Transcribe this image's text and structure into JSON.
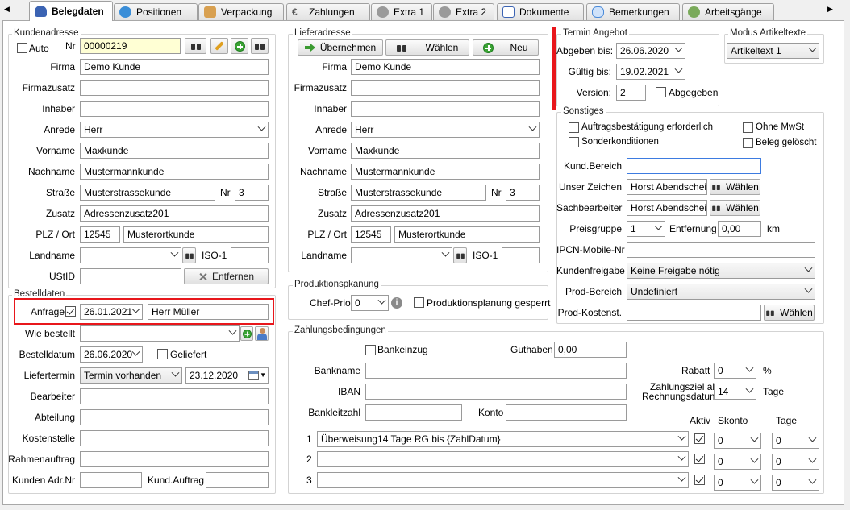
{
  "tabs": [
    {
      "label": "Belegdaten",
      "icon": "user-icon",
      "color": "#3b63b3"
    },
    {
      "label": "Positionen",
      "icon": "gears-icon",
      "color": "#3a8ed8"
    },
    {
      "label": "Verpackung",
      "icon": "box-icon",
      "color": "#d8a050"
    },
    {
      "label": "Zahlungen",
      "icon": "euro-icon",
      "color": "#555555"
    },
    {
      "label": "Extra 1",
      "icon": "gear-icon",
      "color": "#888888"
    },
    {
      "label": "Extra 2",
      "icon": "gear-icon",
      "color": "#888888"
    },
    {
      "label": "Dokumente",
      "icon": "document-icon",
      "color": "#3b63b3"
    },
    {
      "label": "Bemerkungen",
      "icon": "speech-bubble-icon",
      "color": "#4a8ad8"
    },
    {
      "label": "Arbeitsgänge",
      "icon": "cog-icon",
      "color": "#6a9a4a"
    }
  ],
  "kunde": {
    "title": "Kundenadresse",
    "auto_label": "Auto",
    "nr_label": "Nr",
    "nr_value": "00000219",
    "fields": [
      {
        "label": "Firma",
        "value": "Demo Kunde"
      },
      {
        "label": "Firmazusatz",
        "value": ""
      },
      {
        "label": "Inhaber",
        "value": ""
      },
      {
        "label": "Anrede",
        "value": "Herr"
      },
      {
        "label": "Vorname",
        "value": "Maxkunde"
      },
      {
        "label": "Nachname",
        "value": "Mustermannkunde"
      },
      {
        "label": "Straße",
        "value": "Musterstrassekunde",
        "nr_label": "Nr",
        "nr": "3"
      },
      {
        "label": "Zusatz",
        "value": "Adressenzusatz201"
      },
      {
        "label": "PLZ / Ort",
        "plz": "12545",
        "ort": "Musterortkunde"
      },
      {
        "label": "Landname",
        "value": "",
        "iso_label": "ISO-1",
        "iso": ""
      },
      {
        "label": "UStID",
        "value": "",
        "button": "Entfernen"
      }
    ]
  },
  "liefer": {
    "title": "Lieferadresse",
    "btn_uebernehmen": "Übernehmen",
    "btn_waehlen": "Wählen",
    "btn_neu": "Neu",
    "fields": [
      {
        "label": "Firma",
        "value": "Demo Kunde"
      },
      {
        "label": "Firmazusatz",
        "value": ""
      },
      {
        "label": "Inhaber",
        "value": ""
      },
      {
        "label": "Anrede",
        "value": "Herr"
      },
      {
        "label": "Vorname",
        "value": "Maxkunde"
      },
      {
        "label": "Nachname",
        "value": "Mustermannkunde"
      },
      {
        "label": "Straße",
        "value": "Musterstrassekunde",
        "nr_label": "Nr",
        "nr": "3"
      },
      {
        "label": "Zusatz",
        "value": "Adressenzusatz201"
      },
      {
        "label": "PLZ / Ort",
        "plz": "12545",
        "ort": "Musterortkunde"
      },
      {
        "label": "Landname",
        "value": "",
        "iso_label": "ISO-1",
        "iso": ""
      }
    ]
  },
  "bestell": {
    "title": "Bestelldaten",
    "anfrage_label": "Anfrage",
    "anfrage_date": "26.01.2021",
    "anfrage_person": "Herr Müller",
    "wie_label": "Wie bestellt",
    "wie_value": "",
    "datum_label": "Bestelldatum",
    "datum_value": "26.06.2020",
    "geliefert_label": "Geliefert",
    "liefertermin_label": "Liefertermin",
    "liefertermin_value": "Termin vorhanden",
    "liefertermin_date": "23.12.2020",
    "bearbeiter_label": "Bearbeiter",
    "abteilung_label": "Abteilung",
    "kostenstelle_label": "Kostenstelle",
    "rahmen_label": "Rahmenauftrag",
    "kunden_adr_label": "Kunden Adr.Nr",
    "kund_auftrag_label": "Kund.Auftrag"
  },
  "produktion": {
    "title": "Produktionspkanung",
    "chef_label": "Chef-Prio",
    "chef_value": "0",
    "gesperrt_label": "Produktionsplanung gesperrt"
  },
  "termin": {
    "title": "Termin Angebot",
    "abgeben_label": "Abgeben bis:",
    "abgeben_value": "26.06.2020",
    "gueltig_label": "Gültig bis:",
    "gueltig_value": "19.02.2021",
    "version_label": "Version:",
    "version_value": "2",
    "abgegeben_label": "Abgegeben"
  },
  "modus": {
    "title": "Modus Artikeltexte",
    "value": "Artikeltext 1"
  },
  "sonstiges": {
    "title": "Sonstiges",
    "auftrag_label": "Auftragsbestätigung erforderlich",
    "ohne_mwst_label": "Ohne MwSt",
    "sonder_label": "Sonderkonditionen",
    "geloescht_label": "Beleg gelöscht",
    "kund_bereich_label": "Kund.Bereich",
    "kund_bereich_value": "",
    "unser_zeichen_label": "Unser Zeichen",
    "unser_zeichen_value": "Horst Abendschein",
    "sachbearbeiter_label": "Sachbearbeiter",
    "sachbearbeiter_value": "Horst Abendschein",
    "waehlen": "Wählen",
    "preisgruppe_label": "Preisgruppe",
    "preisgruppe_value": "1",
    "entfernung_label": "Entfernung",
    "entfernung_value": "0,00",
    "km": "km",
    "ipcn_label": "IPCN-Mobile-Nr",
    "ipcn_value": "",
    "kundenfreigabe_label": "Kundenfreigabe",
    "kundenfreigabe_value": "Keine Freigabe nötig",
    "prod_bereich_label": "Prod-Bereich",
    "prod_bereich_value": "Undefiniert",
    "prod_kosten_label": "Prod-Kostenst.",
    "prod_kosten_value": ""
  },
  "zahlung": {
    "title": "Zahlungsbedingungen",
    "bankeinzug_label": "Bankeinzug",
    "guthaben_label": "Guthaben",
    "guthaben_value": "0,00",
    "bankname_label": "Bankname",
    "iban_label": "IBAN",
    "blz_label": "Bankleitzahl",
    "konto_label": "Konto",
    "rabatt_label": "Rabatt",
    "rabatt_value": "0",
    "pct": "%",
    "ziel_label_1": "Zahlungsziel ab",
    "ziel_label_2": "Rechnungsdatum",
    "ziel_value": "14",
    "tage": "Tage",
    "aktiv_header": "Aktiv",
    "skonto_header": "Skonto",
    "tage_header": "Tage",
    "rows": [
      {
        "num": "1",
        "text": "Überweisung14 Tage RG bis {ZahlDatum}",
        "skonto": "0",
        "tage": "0"
      },
      {
        "num": "2",
        "text": "",
        "skonto": "0",
        "tage": "0"
      },
      {
        "num": "3",
        "text": "",
        "skonto": "0",
        "tage": "0"
      }
    ]
  },
  "colors": {
    "highlight_red": "#e8161b",
    "yellow_field": "#ffffd4",
    "focus_blue": "#3d7be0"
  }
}
